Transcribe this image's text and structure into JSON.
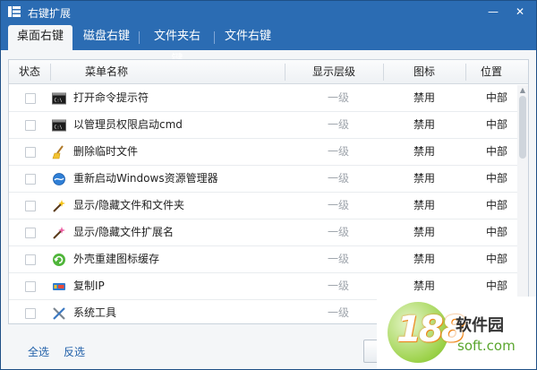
{
  "window": {
    "title": "右键扩展",
    "min_glyph": "—",
    "close_glyph": "✕"
  },
  "tabs": [
    {
      "label": "桌面右键",
      "active": true
    },
    {
      "label": "磁盘右键",
      "active": false
    },
    {
      "label": "文件夹右键",
      "active": false
    },
    {
      "label": "文件右键",
      "active": false
    }
  ],
  "table": {
    "headers": {
      "state": "状态",
      "name": "菜单名称",
      "level": "显示层级",
      "icon": "图标",
      "position": "位置"
    },
    "rows": [
      {
        "name": "打开命令提示符",
        "level": "一级",
        "icon": "禁用",
        "position": "中部",
        "icon_name": "cmd-icon",
        "checked": false
      },
      {
        "name": "以管理员权限启动cmd",
        "level": "一级",
        "icon": "禁用",
        "position": "中部",
        "icon_name": "cmd-admin-icon",
        "checked": false
      },
      {
        "name": "删除临时文件",
        "level": "一级",
        "icon": "禁用",
        "position": "中部",
        "icon_name": "broom-icon",
        "checked": false
      },
      {
        "name": "重新启动Windows资源管理器",
        "level": "一级",
        "icon": "禁用",
        "position": "中部",
        "icon_name": "explorer-icon",
        "checked": false
      },
      {
        "name": "显示/隐藏文件和文件夹",
        "level": "一级",
        "icon": "禁用",
        "position": "中部",
        "icon_name": "magic-wand-icon",
        "checked": false
      },
      {
        "name": "显示/隐藏文件扩展名",
        "level": "一级",
        "icon": "禁用",
        "position": "中部",
        "icon_name": "magic-wand-pink-icon",
        "checked": false
      },
      {
        "name": "外壳重建图标缓存",
        "level": "一级",
        "icon": "禁用",
        "position": "中部",
        "icon_name": "refresh-icon",
        "checked": false
      },
      {
        "name": "复制IP",
        "level": "一级",
        "icon": "禁用",
        "position": "中部",
        "icon_name": "ip-icon",
        "checked": false
      },
      {
        "name": "系统工具",
        "level": "一级",
        "icon": "禁用",
        "position": "中部",
        "icon_name": "tools-icon",
        "checked": false
      }
    ]
  },
  "footer": {
    "select_all": "全选",
    "invert": "反选"
  },
  "watermark": {
    "logo_number": "188",
    "title": "软件园",
    "subtitle": "soft.com"
  },
  "colors": {
    "titlebar": "#2b6cb3",
    "link": "#1f5fa8",
    "level_text": "#a0a6ad"
  }
}
